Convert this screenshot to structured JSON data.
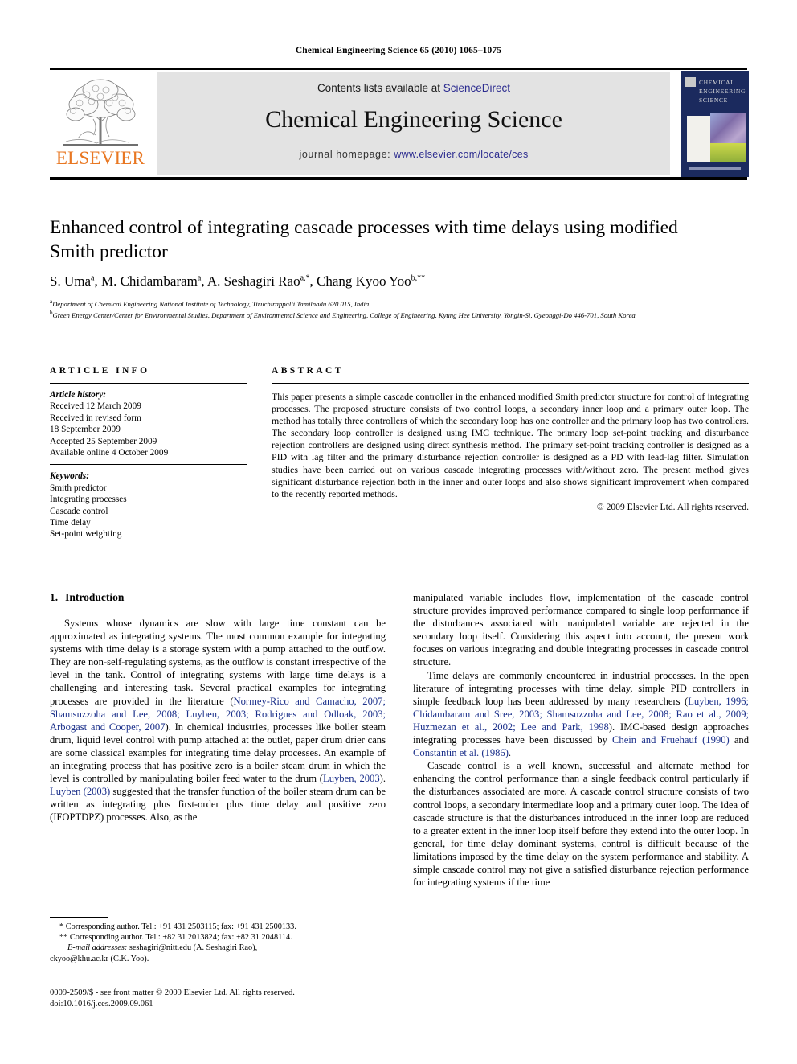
{
  "running_head": "Chemical Engineering Science 65 (2010) 1065–1075",
  "masthead": {
    "contents_prefix": "Contents lists available at ",
    "sciencedirect": "ScienceDirect",
    "journal_title": "Chemical Engineering Science",
    "homepage_prefix": "journal homepage: ",
    "homepage_url": "www.elsevier.com/locate/ces",
    "publisher_logo_text": "ELSEVIER",
    "cover_title": "CHEMICAL ENGINEERING SCIENCE",
    "link_color": "#2b2b8f",
    "elsevier_orange": "#E87722",
    "band_gray": "#e3e3e3",
    "cover_navy": "#1b2a5e"
  },
  "article": {
    "title": "Enhanced control of integrating cascade processes with time delays using modified Smith predictor",
    "authors": "S. Uma a, M. Chidambaram a, A. Seshagiri Rao a,*, Chang Kyoo Yoo b,**",
    "authors_parts": [
      {
        "name": "S. Uma",
        "sup": "a"
      },
      {
        "name": "M. Chidambaram",
        "sup": "a"
      },
      {
        "name": "A. Seshagiri Rao",
        "sup": "a,*"
      },
      {
        "name": "Chang Kyoo Yoo",
        "sup": "b,**"
      }
    ],
    "affiliations": [
      {
        "sup": "a",
        "text": "Department of Chemical Engineering National Institute of Technology, Tiruchirappalli Tamilnadu 620 015, India"
      },
      {
        "sup": "b",
        "text": "Green Energy Center/Center for Environmental Studies, Department of Environmental Science and Engineering, College of Engineering, Kyung Hee University, Yongin-Si, Gyeonggi-Do 446-701, South Korea"
      }
    ]
  },
  "article_info": {
    "heading": "ARTICLE INFO",
    "history_label": "Article history:",
    "history": [
      "Received 12 March 2009",
      "Received in revised form",
      "18 September 2009",
      "Accepted 25 September 2009",
      "Available online 4 October 2009"
    ],
    "keywords_label": "Keywords:",
    "keywords": [
      "Smith predictor",
      "Integrating processes",
      "Cascade control",
      "Time delay",
      "Set-point weighting"
    ]
  },
  "abstract": {
    "heading": "ABSTRACT",
    "text": "This paper presents a simple cascade controller in the enhanced modified Smith predictor structure for control of integrating processes. The proposed structure consists of two control loops, a secondary inner loop and a primary outer loop. The method has totally three controllers of which the secondary loop has one controller and the primary loop has two controllers. The secondary loop controller is designed using IMC technique. The primary loop set-point tracking and disturbance rejection controllers are designed using direct synthesis method. The primary set-point tracking controller is designed as a PID with lag filter and the primary disturbance rejection controller is designed as a PD with lead-lag filter. Simulation studies have been carried out on various cascade integrating processes with/without zero. The present method gives significant disturbance rejection both in the inner and outer loops and also shows significant improvement when compared to the recently reported methods.",
    "copyright": "© 2009 Elsevier Ltd. All rights reserved."
  },
  "section": {
    "number": "1.",
    "title": "Introduction"
  },
  "body": {
    "left_p1_a": "Systems whose dynamics are slow with large time constant can be approximated as integrating systems. The most common example for integrating systems with time delay is a storage system with a pump attached to the outflow. They are non-self-regulating systems, as the outflow is constant irrespective of the level in the tank. Control of integrating systems with large time delays is a challenging and interesting task. Several practical examples for integrating processes are provided in the literature (",
    "left_p1_ref1": "Normey-Rico and Camacho, 2007; Shamsuzzoha and Lee, 2008; Luyben, 2003; Rodrigues and Odloak, 2003; Arbogast and Cooper, 2007",
    "left_p1_b": "). In chemical industries, processes like boiler steam drum, liquid level control with pump attached at the outlet, paper drum drier cans are some classical examples for integrating time delay processes. An example of an integrating process that has positive zero is a boiler steam drum in which the level is controlled by manipulating boiler feed water to the drum (",
    "left_p1_ref2": "Luyben, 2003",
    "left_p1_c": "). ",
    "left_p1_ref3": "Luyben (2003)",
    "left_p1_d": " suggested that the transfer function of the boiler steam drum can be written as integrating plus first-order plus time delay and positive zero (IFOPTDPZ) processes. Also, as the",
    "right_p1": "manipulated variable includes flow, implementation of the cascade control structure provides improved performance compared to single loop performance if the disturbances associated with manipulated variable are rejected in the secondary loop itself. Considering this aspect into account, the present work focuses on various integrating and double integrating processes in cascade control structure.",
    "right_p2_a": "Time delays are commonly encountered in industrial processes. In the open literature of integrating processes with time delay, simple PID controllers in simple feedback loop has been addressed by many researchers (",
    "right_p2_ref1": "Luyben, 1996; Chidambaram and Sree, 2003; Shamsuzzoha and Lee, 2008; Rao et al., 2009; Huzmezan et al., 2002; Lee and Park, 1998",
    "right_p2_b": "). IMC-based design approaches integrating processes have been discussed by ",
    "right_p2_ref2": "Chein and Fruehauf (1990)",
    "right_p2_c": " and ",
    "right_p2_ref3": "Constantin et al. (1986)",
    "right_p2_d": ".",
    "right_p3": "Cascade control is a well known, successful and alternate method for enhancing the control performance than a single feedback control particularly if the disturbances associated are more. A cascade control structure consists of two control loops, a secondary intermediate loop and a primary outer loop. The idea of cascade structure is that the disturbances introduced in the inner loop are reduced to a greater extent in the inner loop itself before they extend into the outer loop. In general, for time delay dominant systems, control is difficult because of the limitations imposed by the time delay on the system performance and stability. A simple cascade control may not give a satisfied disturbance rejection performance for integrating systems if the time"
  },
  "footnotes": {
    "corresponding1": "* Corresponding author. Tel.: +91 431 2503115; fax: +91 431 2500133.",
    "corresponding2": "** Corresponding author. Tel.: +82 31 2013824; fax: +82 31 2048114.",
    "email_label": "E-mail addresses:",
    "email_text": " seshagiri@nitt.edu (A. Seshagiri Rao),",
    "email_text2": "ckyoo@khu.ac.kr (C.K. Yoo).",
    "imprint_line1": "0009-2509/$ - see front matter © 2009 Elsevier Ltd. All rights reserved.",
    "imprint_line2": "doi:10.1016/j.ces.2009.09.061"
  }
}
